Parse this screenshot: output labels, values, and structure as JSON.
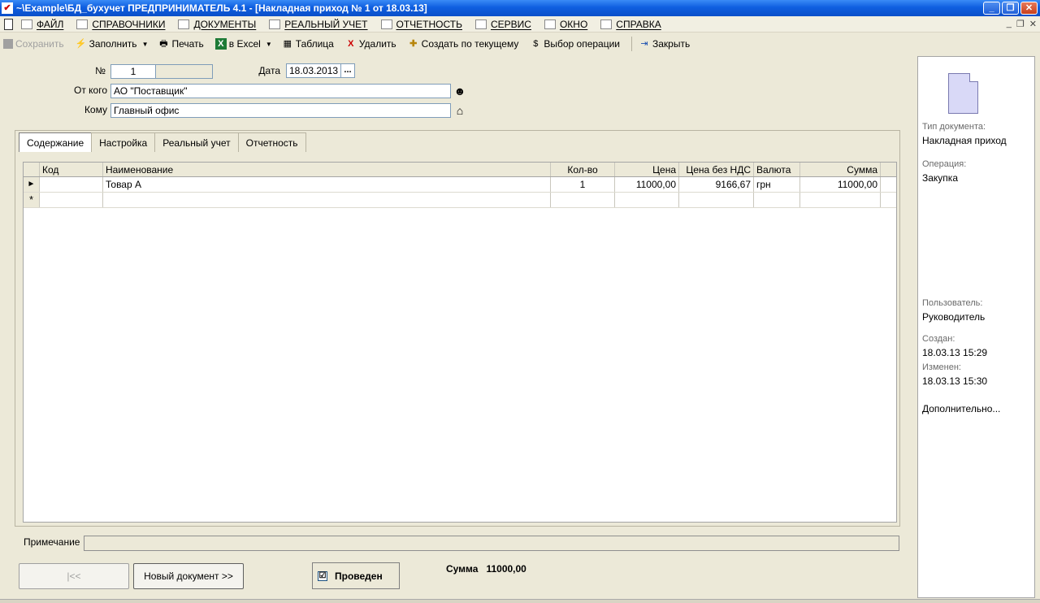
{
  "window": {
    "title": "~\\Example\\БД_бухучет  ПРЕДПРИНИМАТЕЛЬ 4.1 - [Накладная приход № 1 от 18.03.13]"
  },
  "menu": [
    {
      "label": "ФАЙЛ",
      "icon": "folder-icon"
    },
    {
      "label": "СПРАВОЧНИКИ",
      "icon": "home-icon"
    },
    {
      "label": "ДОКУМЕНТЫ",
      "icon": "document-icon"
    },
    {
      "label": "РЕАЛЬНЫЙ УЧЕТ",
      "icon": "ledger-icon"
    },
    {
      "label": "ОТЧЕТНОСТЬ",
      "icon": "report-icon"
    },
    {
      "label": "СЕРВИС",
      "icon": "calculator-icon"
    },
    {
      "label": "ОКНО",
      "icon": "window-icon"
    },
    {
      "label": "СПРАВКА",
      "icon": "help-icon"
    }
  ],
  "toolbar": {
    "save": "Сохранить",
    "fill": "Заполнить",
    "print": "Печать",
    "excel": "в Excel",
    "table": "Таблица",
    "delete": "Удалить",
    "create_from": "Создать по текущему",
    "select_operation": "Выбор операции",
    "close": "Закрыть"
  },
  "header": {
    "number_label": "№",
    "number_value": "1",
    "date_label": "Дата",
    "date_value": "18.03.2013",
    "date_btn": "...",
    "from_label": "От кого",
    "from_value": "АО \"Поставщик\"",
    "to_label": "Кому",
    "to_value": "Главный офис"
  },
  "tabs": [
    "Содержание",
    "Настройка",
    "Реальный учет",
    "Отчетность"
  ],
  "grid": {
    "columns": [
      "Код",
      "Наименование",
      "Кол-во",
      "Цена",
      "Цена без НДС",
      "Валюта",
      "Сумма"
    ],
    "rows": [
      {
        "indicator": "►",
        "code": "",
        "name": "Товар А",
        "qty": "1",
        "price": "11000,00",
        "price_no_vat": "9166,67",
        "currency": "грн",
        "sum": "11000,00"
      },
      {
        "indicator": "*",
        "code": "",
        "name": "",
        "qty": "",
        "price": "",
        "price_no_vat": "",
        "currency": "",
        "sum": ""
      }
    ]
  },
  "info": {
    "doc_type_label": "Тип документа:",
    "doc_type_value": "Накладная приход",
    "operation_label": "Операция:",
    "operation_value": "Закупка",
    "user_label": "Пользователь:",
    "user_value": "Руководитель",
    "created_label": "Создан:",
    "created_value": "18.03.13  15:29",
    "modified_label": "Изменен:",
    "modified_value": "18.03.13  15:30",
    "more": "Дополнительно..."
  },
  "footer": {
    "note_label": "Примечание",
    "first_btn": "|<<",
    "new_doc_btn": "Новый документ >>",
    "posted_label": "Проведен",
    "posted_checked": "☑",
    "sum_label": "Сумма",
    "sum_value": "11000,00"
  }
}
